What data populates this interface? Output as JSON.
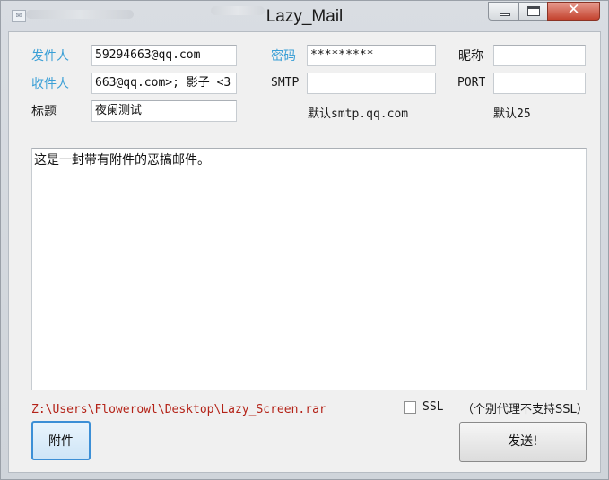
{
  "window": {
    "title": "Lazy_Mail",
    "controls": {
      "minimize": "minimize",
      "maximize": "maximize",
      "close": "close"
    }
  },
  "form": {
    "sender_label": "发件人",
    "sender_value": "59294663@qq.com",
    "recipient_label": "收件人",
    "recipient_value": "663@qq.com>; 影子 <3",
    "subject_label": "标题",
    "subject_value": "夜阑测试",
    "password_label": "密码",
    "password_value": "*********",
    "smtp_label": "SMTP",
    "smtp_value": "",
    "smtp_hint": "默认smtp.qq.com",
    "nickname_label": "昵称",
    "nickname_value": "",
    "port_label": "PORT",
    "port_value": "",
    "port_hint": "默认25"
  },
  "message": {
    "body": "这是一封带有附件的恶搞邮件。"
  },
  "attachment": {
    "path": "Z:\\Users\\Flowerowl\\Desktop\\Lazy_Screen.rar",
    "button_label": "附件"
  },
  "options": {
    "ssl_label": "SSL",
    "ssl_checked": false,
    "ssl_note": "（个别代理不支持SSL）"
  },
  "actions": {
    "send_label": "发送!"
  },
  "colors": {
    "label_blue": "#3a9fd6",
    "path_red": "#b42318",
    "close_red": "#c4432f"
  }
}
